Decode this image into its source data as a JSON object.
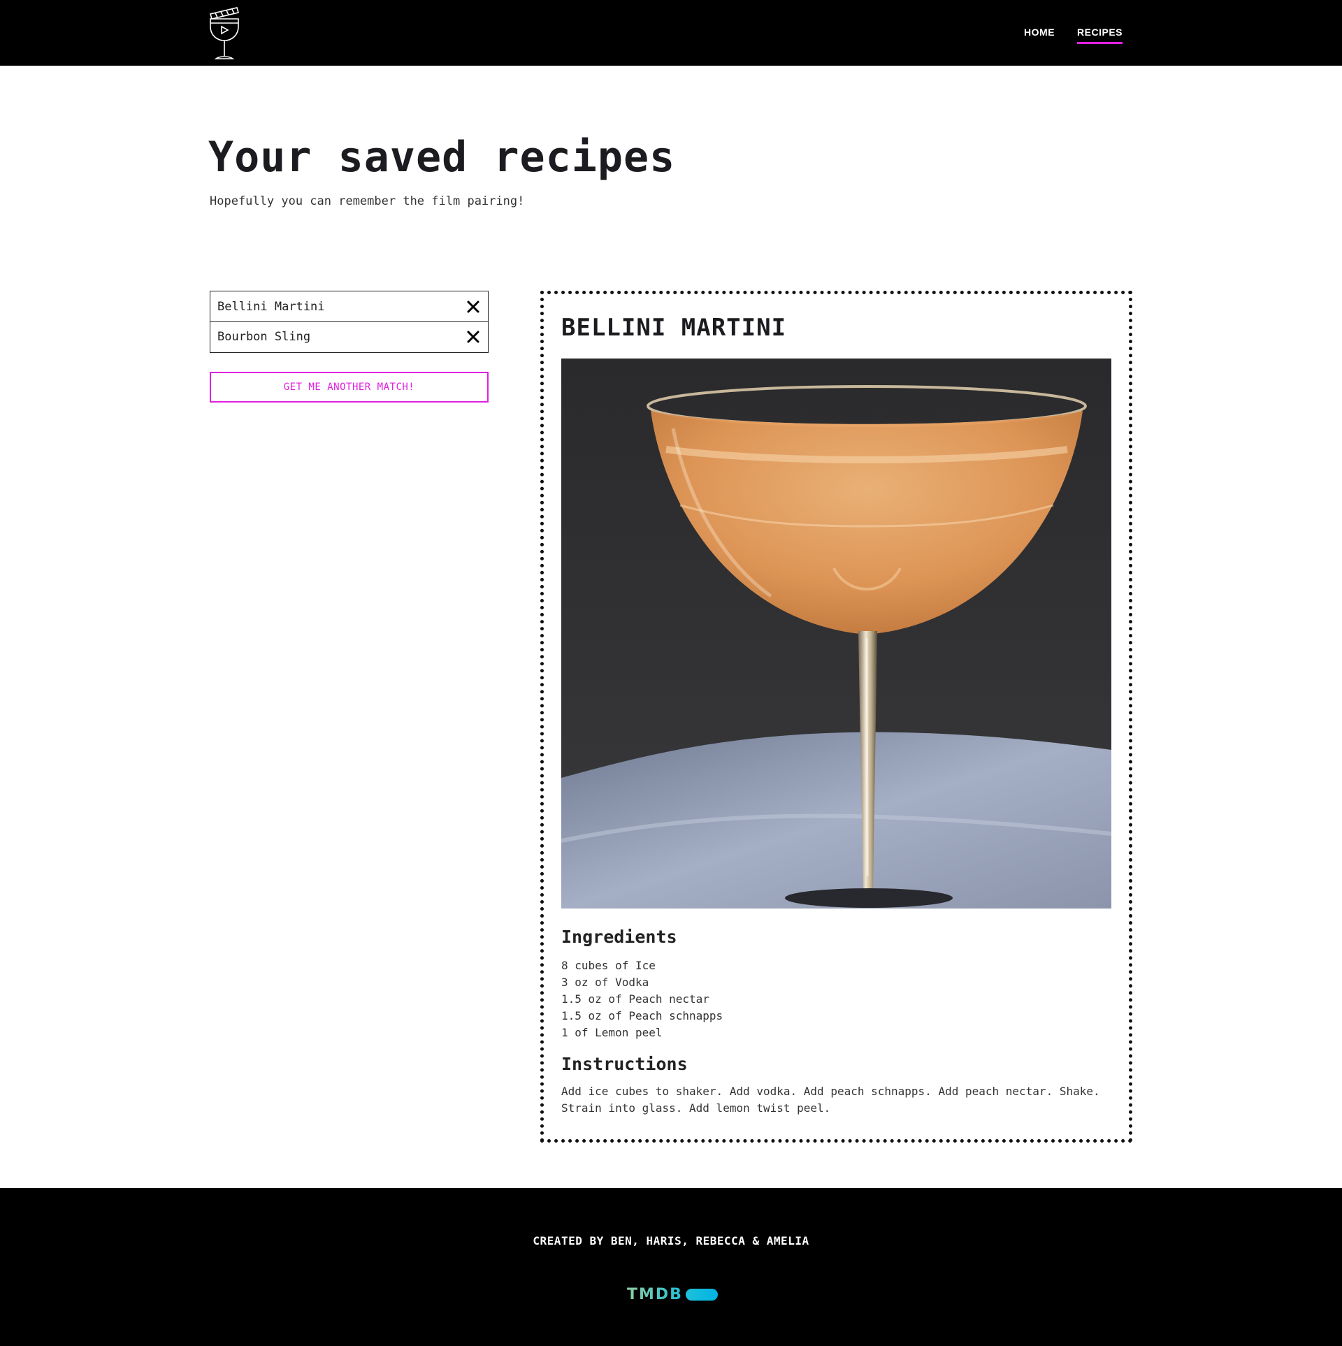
{
  "nav": {
    "logo_icon": "cocktail-glass-clapperboard-icon",
    "links": [
      {
        "label": "HOME",
        "active": false
      },
      {
        "label": "RECIPES",
        "active": true
      }
    ],
    "accent_color": "#e020e0"
  },
  "hero": {
    "title": "Your saved recipes",
    "subtitle": "Hopefully you can remember the film pairing!"
  },
  "saved": {
    "items": [
      {
        "name": "Bellini Martini",
        "remove_icon": "close-icon"
      },
      {
        "name": "Bourbon Sling",
        "remove_icon": "close-icon"
      }
    ],
    "match_button": "GET ME ANOTHER MATCH!"
  },
  "recipe": {
    "name": "BELLINI MARTINI",
    "image_icon": "cocktail-photo",
    "ingredients_heading": "Ingredients",
    "ingredients": [
      "8 cubes of Ice",
      "3 oz of Vodka",
      "1.5 oz of Peach nectar",
      "1.5 oz of Peach schnapps",
      "1 of Lemon peel"
    ],
    "instructions_heading": "Instructions",
    "instructions": "Add ice cubes to shaker. Add vodka. Add peach schnapps. Add peach nectar. Shake. Strain into glass. Add lemon twist peel."
  },
  "footer": {
    "credits": "CREATED BY BEN, HARIS, REBECCA & AMELIA",
    "tmdb_label": "TMDB"
  }
}
